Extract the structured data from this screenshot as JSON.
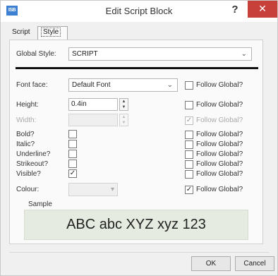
{
  "window": {
    "title": "Edit Script Block",
    "icon_text": "ISB",
    "help_label": "?",
    "close_label": "✕"
  },
  "tabs": [
    {
      "label": "Script",
      "active": false
    },
    {
      "label": "Style",
      "active": true
    }
  ],
  "global_style": {
    "label": "Global Style:",
    "value": "SCRIPT"
  },
  "font_face": {
    "label": "Font face:",
    "value": "Default Font"
  },
  "height": {
    "label": "Height:",
    "value": "0.4in"
  },
  "width": {
    "label": "Width:",
    "value": ""
  },
  "follow_global_label": "Follow Global?",
  "options": [
    {
      "label": "Bold?",
      "checked": false,
      "follow_global": false
    },
    {
      "label": "Italic?",
      "checked": false,
      "follow_global": false
    },
    {
      "label": "Underline?",
      "checked": false,
      "follow_global": false
    },
    {
      "label": "Strikeout?",
      "checked": false,
      "follow_global": false
    },
    {
      "label": "Visible?",
      "checked": true,
      "follow_global": false
    }
  ],
  "follow_global": {
    "font_face": false,
    "height": false,
    "width": true,
    "colour": true
  },
  "colour": {
    "label": "Colour:",
    "value": ""
  },
  "sample": {
    "label": "Sample",
    "text": "ABC abc XYZ xyz 123"
  },
  "buttons": {
    "ok": "OK",
    "cancel": "Cancel"
  },
  "colors": {
    "close_button": "#c7413a",
    "sample_background": "#e5ebe0"
  }
}
